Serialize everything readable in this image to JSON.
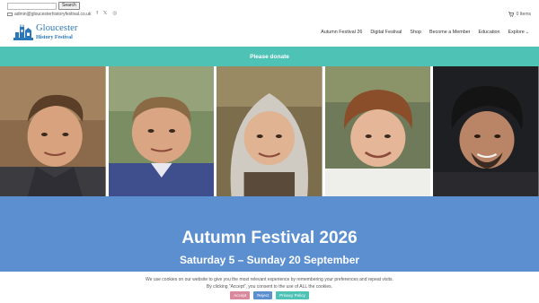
{
  "topbar": {
    "search_placeholder": "",
    "search_button": "Search",
    "email": "admin@gloucesterhistoryfestival.co.uk",
    "social": [
      {
        "name": "facebook-icon",
        "glyph": "f"
      },
      {
        "name": "x-icon",
        "glyph": "𝕏"
      },
      {
        "name": "instagram-icon",
        "glyph": "◎"
      }
    ],
    "cart_label": "0 Items"
  },
  "header": {
    "logo_line1": "Gloucester",
    "logo_line2": "History Festival",
    "nav": [
      {
        "label": "Autumn Festival 26",
        "dropdown": false
      },
      {
        "label": "Digital Festival",
        "dropdown": false
      },
      {
        "label": "Shop",
        "dropdown": false
      },
      {
        "label": "Become a Member",
        "dropdown": false
      },
      {
        "label": "Education",
        "dropdown": false
      },
      {
        "label": "Explore",
        "dropdown": true
      }
    ]
  },
  "donate": {
    "label": "Please donate"
  },
  "hero": {
    "title": "Autumn Festival 2026",
    "dates": "Saturday 5 – Sunday 20 September"
  },
  "cookie": {
    "line1": "We use cookies on our website to give you the most relevant experience by remembering your preferences and repeat visits.",
    "line2": "By clicking “Accept”, you consent to the use of ALL the cookies.",
    "accept": "Accept",
    "reject": "Reject",
    "policy": "Privacy Policy"
  },
  "colors": {
    "teal": "#4fc2b6",
    "hero_blue": "#5b8fd0",
    "logo_blue": "#2a77b9",
    "accept_pink": "#d9889e"
  }
}
